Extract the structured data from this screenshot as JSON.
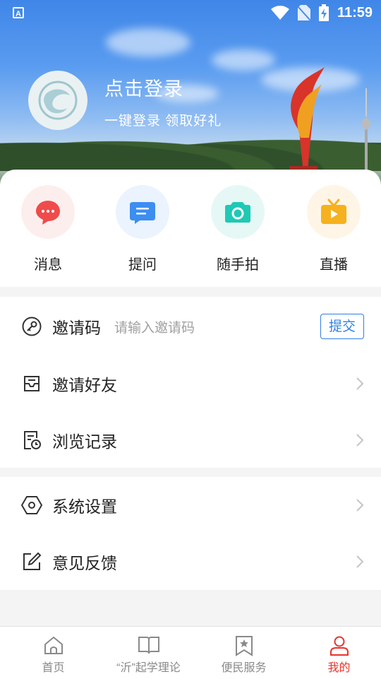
{
  "status_bar": {
    "time": "11:59",
    "app_icon": "A"
  },
  "header": {
    "login_title": "点击登录",
    "login_subtitle": "一键登录  领取好礼"
  },
  "quick_actions": [
    {
      "label": "消息",
      "icon": "message-icon",
      "color": "#f04b4b"
    },
    {
      "label": "提问",
      "icon": "question-icon",
      "color": "#3c8ef0"
    },
    {
      "label": "随手拍",
      "icon": "camera-icon",
      "color": "#1ec9b6"
    },
    {
      "label": "直播",
      "icon": "tv-icon",
      "color": "#f6b11f"
    }
  ],
  "invite": {
    "label": "邀请码",
    "placeholder": "请输入邀请码",
    "submit_label": "提交"
  },
  "menu": {
    "invite_friends": "邀请好友",
    "history": "浏览记录",
    "settings": "系统设置",
    "feedback": "意见反馈"
  },
  "tabbar": [
    {
      "label": "首页",
      "icon": "home-icon"
    },
    {
      "label": "“沂”起学理论",
      "icon": "book-icon"
    },
    {
      "label": "便民服务",
      "icon": "star-bookmark-icon"
    },
    {
      "label": "我的",
      "icon": "user-icon",
      "active": true
    }
  ],
  "colors": {
    "accent": "#2f7ee6",
    "active_tab": "#e8332b"
  }
}
